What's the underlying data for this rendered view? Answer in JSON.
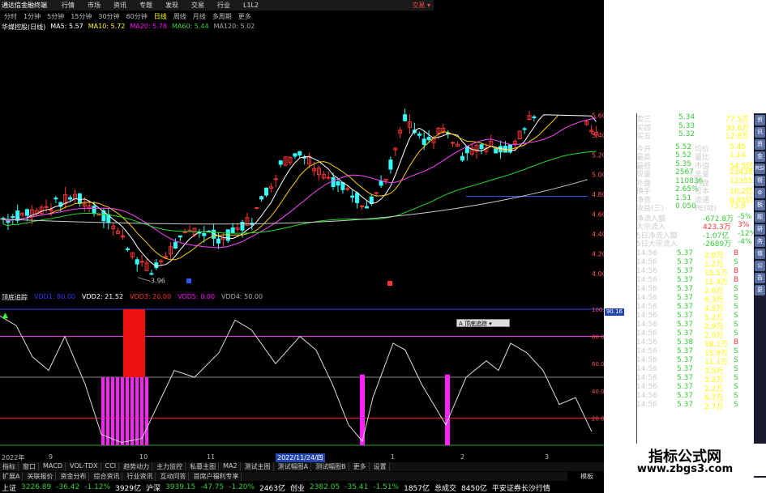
{
  "menubar": {
    "app_title": "通达信金融终端",
    "items": [
      "行情",
      "市场",
      "资讯",
      "专题",
      "发现",
      "交易",
      "行业",
      "L1L2"
    ],
    "alert": "交易 ▾"
  },
  "periods": [
    "分时",
    "1分钟",
    "5分钟",
    "15分钟",
    "30分钟",
    "60分钟",
    "日线",
    "周线",
    "月线",
    "多周期",
    "更多"
  ],
  "active_period": "日线",
  "ma_legend": {
    "stock": "华媒控股(日线)",
    "ma5": "MA5: 5.57",
    "ma10": "MA10: 5.72",
    "ma20": "MA20: 5.78",
    "ma60": "MA60: 5.44",
    "ma120": "MA120: 5.02"
  },
  "colors": {
    "up": "#ff3333",
    "down": "#33ffff",
    "ma5": "#ffffff",
    "ma10": "#ffcc00",
    "ma20": "#ff44ff",
    "ma60": "#22dd22",
    "ma120": "#cccccc",
    "vdd": "#ff22ff",
    "vdd_red": "#ee1111"
  },
  "price_axis": [
    "5.60",
    "5.40",
    "5.20",
    "5.00",
    "4.80",
    "4.60",
    "4.40",
    "4.20",
    "4.00"
  ],
  "low_label": "3.96",
  "indicator": {
    "name": "顶底追踪",
    "vdd1": "VDD1: 80.00",
    "vdd2": "VDD2: 21.52",
    "vdd3": "VDD3: 20.00",
    "vdd5": "VDD5: 0.00",
    "vdd4": "VDD4: 50.00",
    "axis": [
      "100.00",
      "80.00",
      "60.00",
      "40.00",
      "20.00"
    ],
    "current_tag": "90.16",
    "popup": "A 顶底追踪 ▾"
  },
  "time_axis": [
    "2022年",
    "9",
    "10",
    "11",
    "2022/11/24/四",
    "1",
    "2",
    "3"
  ],
  "tabs": [
    "指标",
    "窗口",
    "MACD",
    "VOL-TDX",
    "CCI",
    "趋势动力",
    "主力监控",
    "私募主图",
    "MA2",
    "测试主图",
    "测试幅图A",
    "测试幅图B",
    "更多",
    "设置"
  ],
  "tabs2": [
    "扩展A",
    "关联报价",
    "资金分布",
    "综合资讯",
    "行业资讯",
    "互动问答",
    "首席户福利专享"
  ],
  "bottom_right": "模板",
  "status": [
    {
      "name": "上证",
      "value": "3226.89",
      "chg": "-36.42",
      "pct": "-1.12%",
      "amt": "3929亿"
    },
    {
      "name": "沪深",
      "value": "3939.15",
      "chg": "-47.75",
      "pct": "-1.20%",
      "amt": "2463亿"
    },
    {
      "name": "创业",
      "value": "2382.05",
      "chg": "-35.41",
      "pct": "-1.51%",
      "amt": "1857亿"
    }
  ],
  "status_extra": {
    "label": "总成交",
    "value": "8450亿",
    "broker": "平安证券长沙行情"
  },
  "quote": {
    "ask": [
      {
        "label": "卖三",
        "price": "5.34",
        "vol": "77.5万"
      },
      {
        "label": "买四",
        "price": "5.33",
        "vol": "30.6万"
      },
      {
        "label": "买五",
        "price": "5.32",
        "vol": "17.8万"
      }
    ],
    "stats": [
      {
        "l1": "今开",
        "v1": "5.52",
        "l2": "均价",
        "v2": "5.45"
      },
      {
        "l1": "最高",
        "v1": "5.52",
        "l2": "量比",
        "v2": "1.14"
      },
      {
        "l1": "最低",
        "v1": "5.35",
        "l2": "市值",
        "v2": "54.5亿"
      },
      {
        "l1": "现量",
        "v1": "2567",
        "l2": "总量",
        "v2": "234387"
      },
      {
        "l1": "外盘",
        "v1": "110836",
        "l2": "内盘",
        "v2": "123551"
      },
      {
        "l1": "换手",
        "v1": "2.65%",
        "l2": "股本",
        "v2": "10.2亿"
      },
      {
        "l1": "净资",
        "v1": "1.51",
        "l2": "流通",
        "v2": "8.85亿"
      },
      {
        "l1": "收益(三)",
        "v1": "0.050",
        "l2": "PE(动)",
        "v2": "73.9"
      }
    ],
    "flows": [
      {
        "label": "净流入额",
        "value": "-672.8万",
        "pct": "-5%"
      },
      {
        "label": "大宗流入",
        "value": "423.3万",
        "pct": "3%"
      },
      {
        "label": "5日净流入额",
        "value": "-1.07亿",
        "pct": "-12%"
      },
      {
        "label": "5日大宗流入",
        "value": "-2689万",
        "pct": "-4%"
      }
    ],
    "ticks": [
      [
        "14:56",
        "5.37",
        "2.0万",
        "B"
      ],
      [
        "14:56",
        "5.37",
        "1.2万",
        "S"
      ],
      [
        "14:56",
        "5.37",
        "15.5万",
        "B"
      ],
      [
        "14:56",
        "5.37",
        "11.4万",
        "B"
      ],
      [
        "14:56",
        "5.37",
        "2.6万",
        "S"
      ],
      [
        "14:56",
        "5.37",
        "6.3万",
        "S"
      ],
      [
        "14:56",
        "5.37",
        "4.5万",
        "S"
      ],
      [
        "14:56",
        "5.37",
        "5.2万",
        "S"
      ],
      [
        "14:56",
        "5.37",
        "2.9万",
        "S"
      ],
      [
        "14:56",
        "5.37",
        "2.0万",
        "S"
      ],
      [
        "14:56",
        "5.38",
        "18.1万",
        "B"
      ],
      [
        "14:56",
        "5.37",
        "15.9万",
        "S"
      ],
      [
        "14:56",
        "5.37",
        "11.1万",
        "S"
      ],
      [
        "14:56",
        "5.37",
        "3.5万",
        "S"
      ],
      [
        "14:56",
        "5.37",
        "3.2万",
        "S"
      ],
      [
        "14:56",
        "5.37",
        "2.2万",
        "S"
      ],
      [
        "14:56",
        "5.37",
        "6.7万",
        "S"
      ],
      [
        "14:56",
        "5.37",
        "2.7万",
        "S"
      ]
    ]
  },
  "watermark": {
    "title": "指标公式网",
    "url": "www.zbgs3.com"
  },
  "chart_data": {
    "type": "candlestick",
    "note_ma": [
      "MA5",
      "MA10",
      "MA20",
      "MA60",
      "MA120"
    ]
  }
}
